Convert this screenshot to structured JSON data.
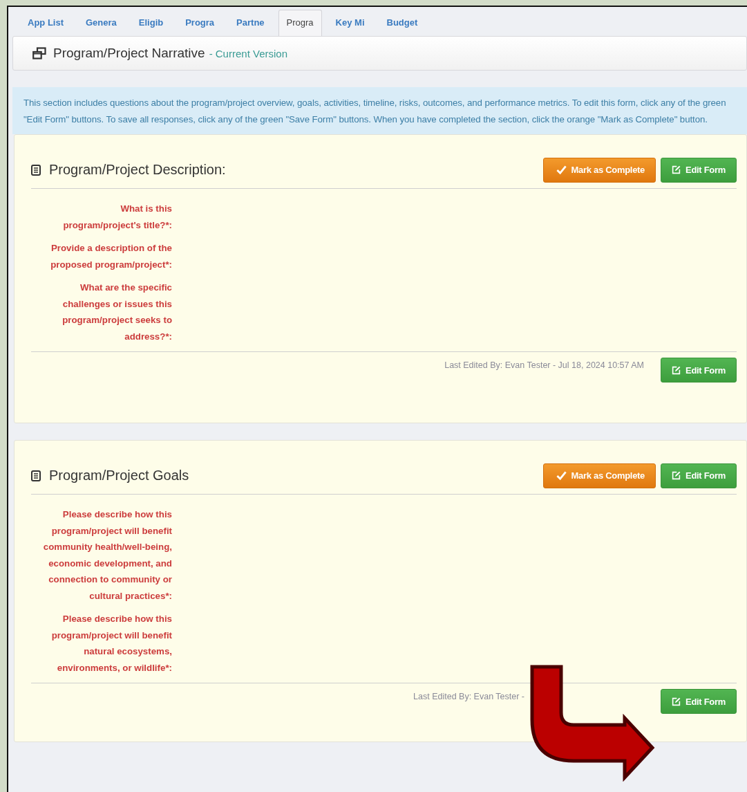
{
  "tabs": [
    {
      "label": "App List",
      "selected": false
    },
    {
      "label": "Genera",
      "selected": false
    },
    {
      "label": "Eligib",
      "selected": false
    },
    {
      "label": "Progra",
      "selected": false
    },
    {
      "label": "Partne",
      "selected": false
    },
    {
      "label": "Progra",
      "selected": true
    },
    {
      "label": "Key Mi",
      "selected": false
    },
    {
      "label": "Budget",
      "selected": false
    }
  ],
  "header": {
    "title": "Program/Project Narrative",
    "subtitle": "- Current Version"
  },
  "info": "This section includes questions about the program/project overview, goals, activities, timeline, risks, outcomes, and performance metrics. To edit this form, click any of the green \"Edit Form\" buttons. To save all responses, click any of the green \"Save Form\" buttons. When you have completed the section, click the orange \"Mark as Complete\" button.",
  "sections": [
    {
      "title": "Program/Project Description:",
      "buttons": [
        {
          "kind": "complete",
          "label": "Mark as Complete"
        },
        {
          "kind": "edit",
          "label": "Edit Form"
        }
      ],
      "questions": [
        "What is this program/project's title?*:",
        "Provide a description of the proposed program/project*:",
        "What are the specific challenges or issues this program/project seeks to address?*:"
      ],
      "footer": {
        "last_edited": "Last Edited By: Evan Tester - Jul 18, 2024 10:57 AM",
        "button": {
          "kind": "edit",
          "label": "Edit Form"
        }
      }
    },
    {
      "title": "Program/Project Goals",
      "buttons": [
        {
          "kind": "complete",
          "label": "Mark as Complete"
        },
        {
          "kind": "edit",
          "label": "Edit Form"
        }
      ],
      "questions": [
        "Please describe how this program/project will benefit community health/well-being, economic development, and connection to community or cultural practices*:",
        "Please describe how this program/project will benefit natural ecosystems, environments, or wildlife*:"
      ],
      "footer": {
        "last_edited": "Last Edited By: Evan Tester -",
        "button": {
          "kind": "edit",
          "label": "Edit Form"
        }
      }
    }
  ]
}
